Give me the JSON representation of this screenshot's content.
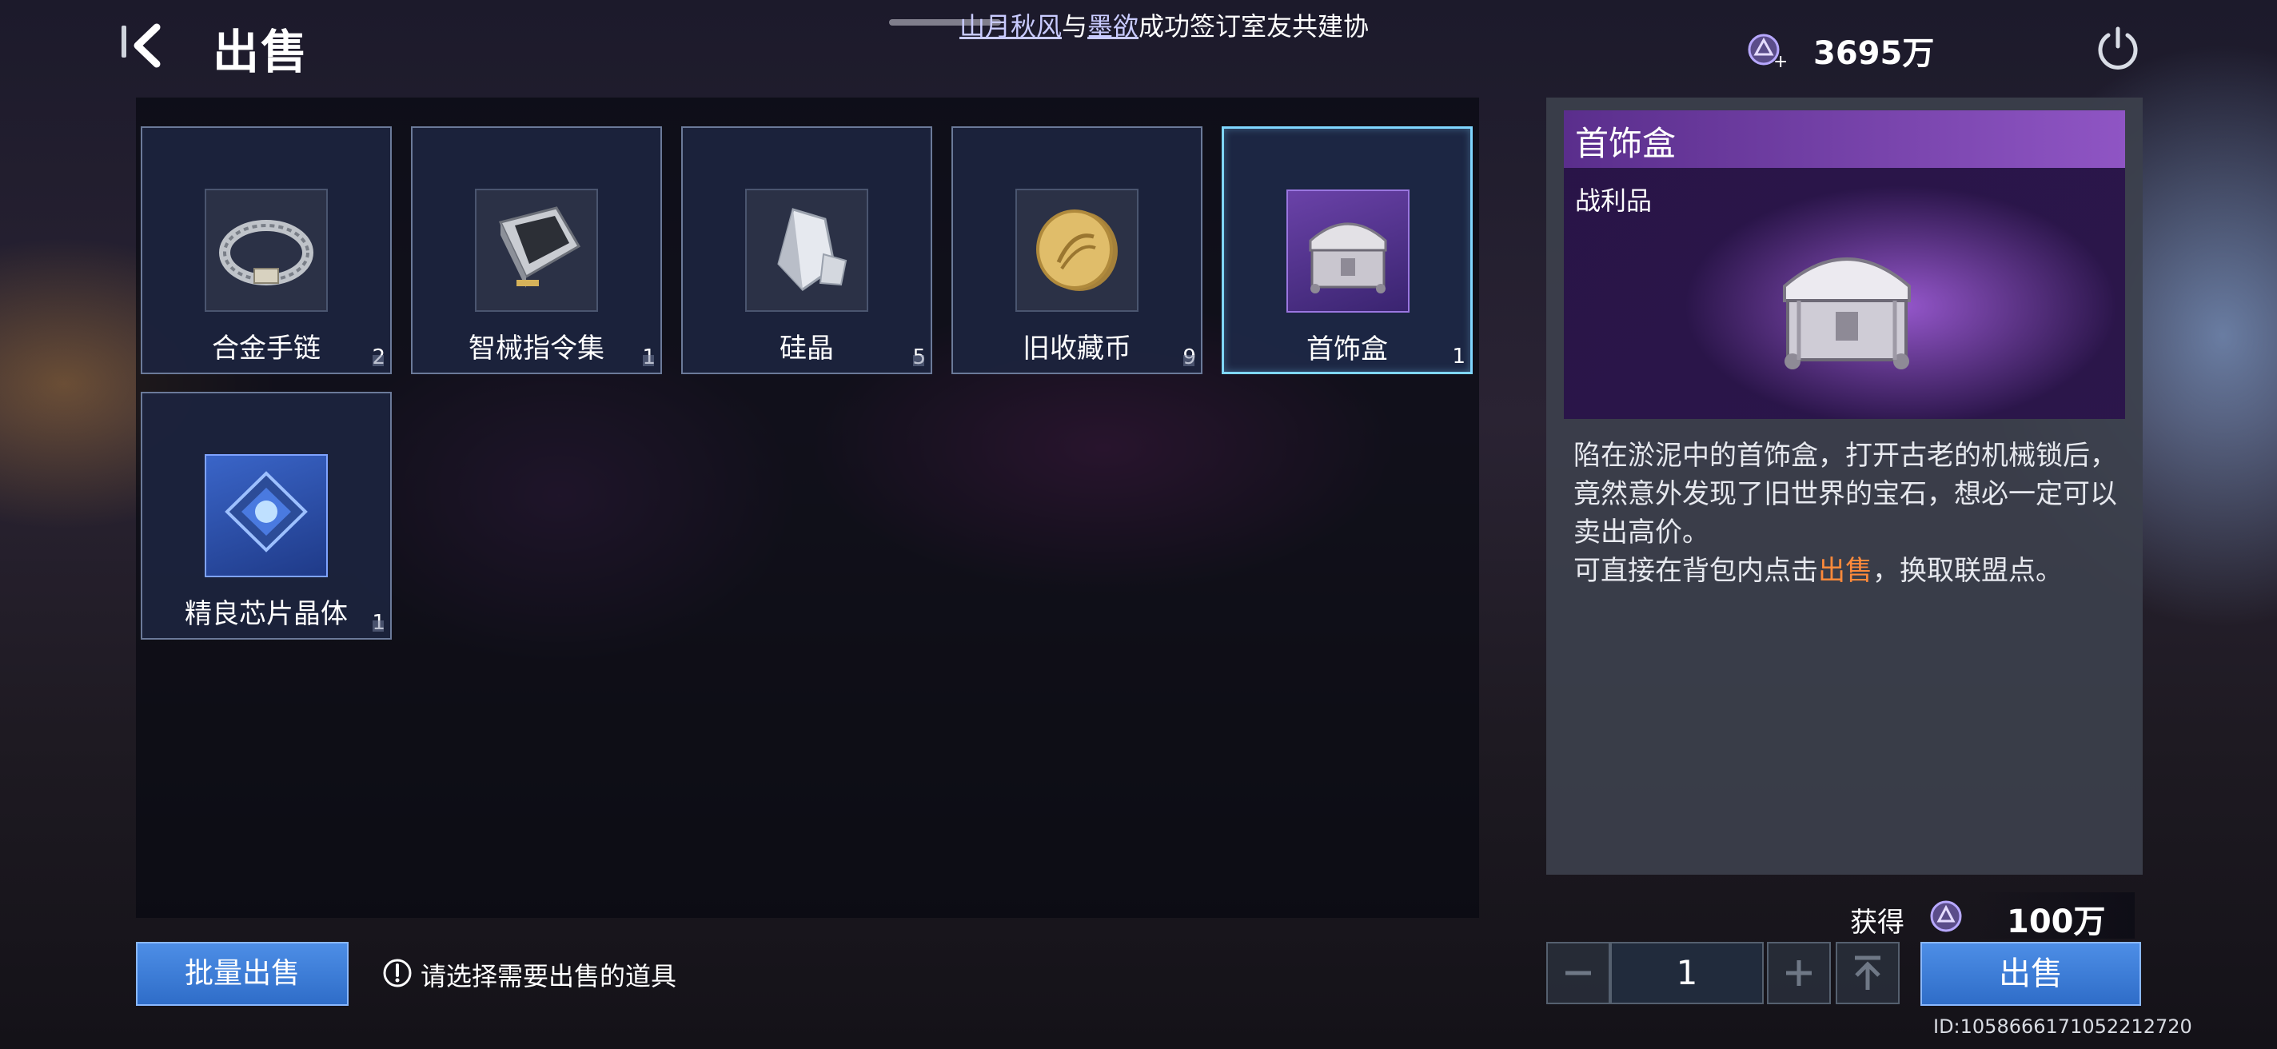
{
  "header": {
    "title": "出售",
    "notice": {
      "name1": "山月秋风",
      "joiner": "与",
      "name2": "墨欲",
      "text": "成功签订室友共建协"
    },
    "currency_value": "3695万"
  },
  "items": [
    {
      "name": "合金手链",
      "qty": "2",
      "icon": "bracelet-icon",
      "rarity": "normal"
    },
    {
      "name": "智械指令集",
      "qty": "1",
      "icon": "chip-card-icon",
      "rarity": "normal"
    },
    {
      "name": "硅晶",
      "qty": "5",
      "icon": "crystal-icon",
      "rarity": "normal"
    },
    {
      "name": "旧收藏币",
      "qty": "9",
      "icon": "coin-icon",
      "rarity": "normal"
    },
    {
      "name": "首饰盒",
      "qty": "1",
      "icon": "jewelry-box-icon",
      "rarity": "epic",
      "selected": true
    },
    {
      "name": "精良芯片晶体",
      "qty": "1",
      "icon": "chip-crystal-icon",
      "rarity": "rare"
    }
  ],
  "detail": {
    "name": "首饰盒",
    "type": "战利品",
    "description": "陷在淤泥中的首饰盒，打开古老的机械锁后，竟然意外发现了旧世界的宝石，想必一定可以卖出高价。",
    "tip_prefix": "可直接在背包内点击",
    "tip_highlight": "出售",
    "tip_suffix": "，换取联盟点。"
  },
  "actions": {
    "batch_sell": "批量出售",
    "hint": "请选择需要出售的道具",
    "gain_label": "获得",
    "gain_value": "100万",
    "quantity": "1",
    "sell": "出售"
  },
  "uid": "ID:1058666171052212720",
  "colors": {
    "accent_blue": "#3a7fd8",
    "highlight_orange": "#ff8a3a",
    "epic_purple": "#8f55c4",
    "selected_border": "#7fd6ff"
  }
}
